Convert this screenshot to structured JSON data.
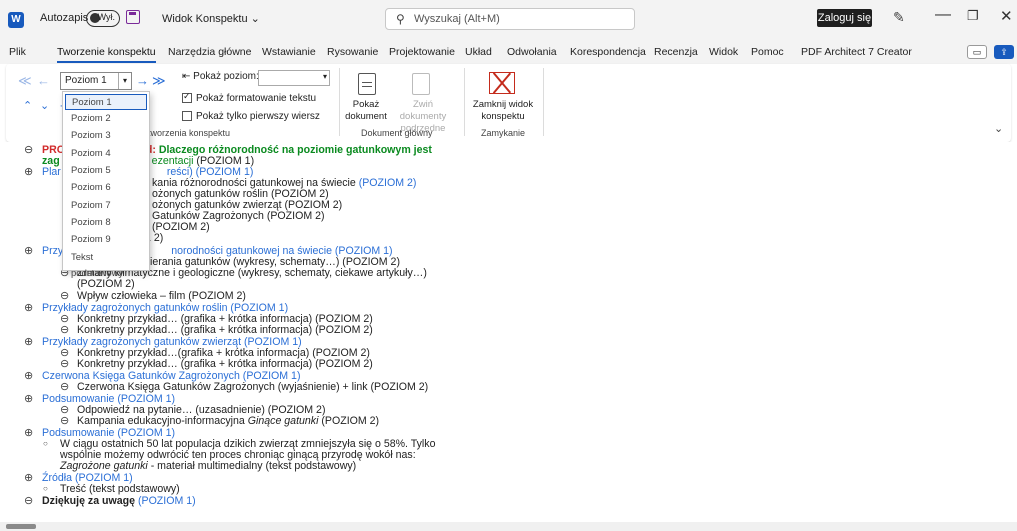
{
  "titlebar": {
    "app_icon": "W",
    "autosave_label": "Autozapis",
    "autosave_state": "Wył.",
    "view_title": "Widok Konspektu ⌄",
    "search_placeholder": "Wyszukaj (Alt+M)",
    "login_label": "Zaloguj się"
  },
  "tabs": [
    "Plik",
    "Tworzenie konspektu",
    "Narzędzia główne",
    "Wstawianie",
    "Rysowanie",
    "Projektowanie",
    "Układ",
    "Odwołania",
    "Korespondencja",
    "Recenzja",
    "Widok",
    "Pomoc",
    "PDF Architect 7 Creator"
  ],
  "ribbon": {
    "level_value": "Poziom 1",
    "show_level_label": "Pokaż poziom:",
    "show_formatting_label": "Pokaż formatowanie tekstu",
    "first_line_label": "Pokaż tylko pierwszy wiersz",
    "outline_tools_group": "Narzędzia tworzenia konspektu",
    "outline_tools_visible": "tworzenia konspektu",
    "show_doc_label1": "Pokaż",
    "show_doc_label2": "dokument",
    "collapse_sub_label1": "Zwiń dokumenty",
    "collapse_sub_label2": "podrzędne",
    "master_doc_group": "Dokument główny",
    "close_view_label1": "Zamknij widok",
    "close_view_label2": "konspektu",
    "close_group": "Zamykanie"
  },
  "level_dropdown": [
    "Poziom 1",
    "Poziom 2",
    "Poziom 3",
    "Poziom 4",
    "Poziom 5",
    "Poziom 6",
    "Poziom 7",
    "Poziom 8",
    "Poziom 9",
    "Tekst podstawowy"
  ],
  "doc": {
    "l1a": "PRO",
    "l1b": "ad: ",
    "l1c": "Dlaczego różnorodność na poziomie gatunkowym jest",
    "l2a": "zag",
    "l2b": "ezentacji",
    "l2c": " (POZIOM 1)",
    "l3a": "Plar",
    "l3b": "reści) (POZIOM 1)",
    "l4a": "kania różnorodności gatunkowej na świecie ",
    "l4b": "(POZIOM 2)",
    "l5": "ożonych gatunków roślin (POZIOM 2)",
    "l6": "ożonych gatunków zwierząt (POZIOM 2)",
    "l7": "Gatunków Zagrożonych (POZIOM 2)",
    "l8": "(POZIOM 2)",
    "l9": "1 2)",
    "l10a": "Przy",
    "l10b": "norodności gatunkowej na świecie (POZIOM 1)",
    "l11": "Przyczyny wymierania gatunków (wykresy, schematy…) (POZIOM 2)",
    "l12": "Zmiany klimatyczne i geologiczne (wykresy, schematy, ciekawe artykuły…)",
    "l13": "(POZIOM 2)",
    "l14": "Wpływ człowieka – film (POZIOM 2)",
    "l15": "Przykłady zagrożonych gatunków roślin (POZIOM 1)",
    "l16": "Konkretny przykład… (grafika + krótka informacja) (POZIOM 2)",
    "l17": "Konkretny przykład… (grafika + krótka informacja) (POZIOM 2)",
    "l18": "Przykłady zagrożonych gatunków zwierząt (POZIOM 1)",
    "l19": "Konkretny przykład…(grafika + krótka informacja) (POZIOM 2)",
    "l20": "Konkretny przykład… (grafika + krótka informacja) (POZIOM 2)",
    "l21": "Czerwona Księga Gatunków Zagrożonych (POZIOM 1)",
    "l22": "Czerwona Księga Gatunków Zagrożonych (wyjaśnienie) + link (POZIOM 2)",
    "l23": "Podsumowanie (POZIOM 1)",
    "l24": "Odpowiedź na pytanie… (uzasadnienie) (POZIOM 2)",
    "l25a": "Kampania edukacyjno-informacyjna ",
    "l25b": "Ginące gatunki",
    "l25c": " (POZIOM 2)",
    "l26": "Podsumowanie (POZIOM 1)",
    "l27": "W ciągu ostatnich 50 lat populacja dzikich zwierząt zmniejszyła się o 58%. Tylko",
    "l28": "wspólnie możemy odwrócić ten proces chroniąc ginącą przyrodę wokół nas:",
    "l29a": "Zagrożone gatunki",
    "l29b": " - materiał multimedialny (tekst podstawowy)",
    "l30": "Źródła (POZIOM 1)",
    "l31": "Treść (tekst podstawowy)",
    "l32a": "Dziękuję za uwagę ",
    "l32b": "(POZIOM 1)"
  }
}
